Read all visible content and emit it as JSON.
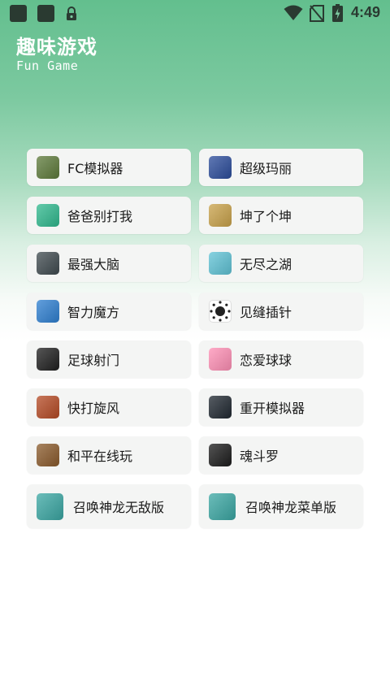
{
  "status_bar": {
    "time": "4:49"
  },
  "header": {
    "title": "趣味游戏",
    "subtitle": "Fun Game"
  },
  "games": [
    [
      {
        "label": "FC模拟器",
        "icon": "fc-emulator-icon",
        "color": "#5d7a3a"
      },
      {
        "label": "超级玛丽",
        "icon": "super-mario-icon",
        "color": "#2b4c9b"
      }
    ],
    [
      {
        "label": "爸爸别打我",
        "icon": "dad-dont-hit-me-icon",
        "color": "#2fb98e"
      },
      {
        "label": "坤了个坤",
        "icon": "kun-kun-icon",
        "color": "#c9a24a"
      }
    ],
    [
      {
        "label": "最强大脑",
        "icon": "strongest-brain-icon",
        "color": "#3f4a4f"
      },
      {
        "label": "无尽之湖",
        "icon": "endless-lake-icon",
        "color": "#5fc3d6"
      }
    ],
    [
      {
        "label": "智力魔方",
        "icon": "rubiks-cube-icon",
        "color": "#2e7fd1"
      },
      {
        "label": "见缝插针",
        "icon": "pin-circle-icon",
        "color": "#ffffff"
      }
    ],
    [
      {
        "label": "足球射门",
        "icon": "soccer-ball-icon",
        "color": "#1e1e1e"
      },
      {
        "label": "恋爱球球",
        "icon": "love-balls-icon",
        "color": "#ff8fb5"
      }
    ],
    [
      {
        "label": "快打旋风",
        "icon": "final-fight-icon",
        "color": "#b54a24"
      },
      {
        "label": "重开模拟器",
        "icon": "restart-simulator-icon",
        "color": "#1f2730"
      }
    ],
    [
      {
        "label": "和平在线玩",
        "icon": "peace-elite-icon",
        "color": "#8a5a2b"
      },
      {
        "label": "魂斗罗",
        "icon": "contra-icon",
        "color": "#1b1b1b"
      }
    ],
    [
      {
        "label": "召唤神龙无敌版",
        "icon": "dragon-invincible-icon",
        "color": "#3aa7a3"
      },
      {
        "label": "召唤神龙菜单版",
        "icon": "dragon-menu-icon",
        "color": "#3aa7a3"
      }
    ]
  ]
}
